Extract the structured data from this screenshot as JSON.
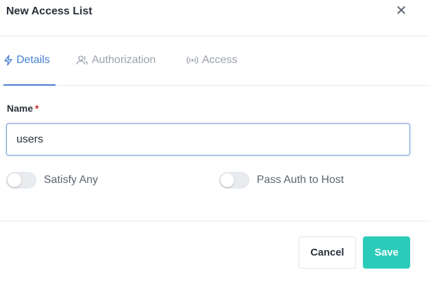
{
  "modal": {
    "title": "New Access List",
    "close_icon": "close-icon"
  },
  "tabs": [
    {
      "label": "Details",
      "icon": "lightning-icon",
      "active": true
    },
    {
      "label": "Authorization",
      "icon": "users-icon",
      "active": false
    },
    {
      "label": "Access",
      "icon": "broadcast-icon",
      "active": false
    }
  ],
  "form": {
    "name_label": "Name",
    "required_mark": "*",
    "name_value": "users",
    "satisfy_any": {
      "label": "Satisfy Any",
      "checked": false
    },
    "pass_auth": {
      "label": "Pass Auth to Host",
      "checked": false
    }
  },
  "footer": {
    "cancel_label": "Cancel",
    "save_label": "Save"
  },
  "colors": {
    "accent": "#467fcf",
    "save": "#2bcbba",
    "required": "#cd201f"
  }
}
